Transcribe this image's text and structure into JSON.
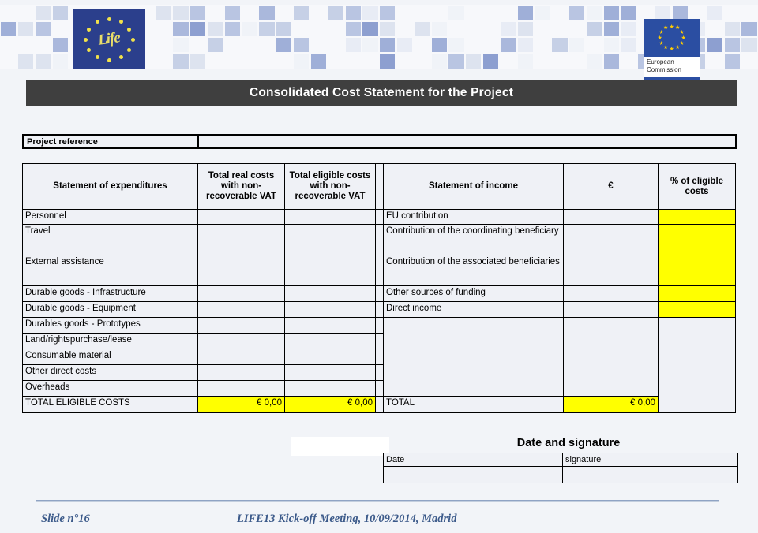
{
  "header": {
    "life_logo_word": "Life",
    "ec_logo_line1": "European",
    "ec_logo_line2": "Commission"
  },
  "title": "Consolidated Cost Statement for the Project",
  "project_reference": {
    "label": "Project reference",
    "value": ""
  },
  "expenditure_table": {
    "headers": {
      "col1": "Statement of expenditures",
      "col2": "Total real costs with non-recoverable VAT",
      "col3": "Total eligible costs with non-recoverable VAT"
    },
    "rows": [
      {
        "label": "Personnel",
        "real": "",
        "eligible": ""
      },
      {
        "label": "Travel",
        "real": "",
        "eligible": ""
      },
      {
        "label": "External assistance",
        "real": "",
        "eligible": ""
      },
      {
        "label": "Durable goods - Infrastructure",
        "real": "",
        "eligible": ""
      },
      {
        "label": "Durable goods - Equipment",
        "real": "",
        "eligible": ""
      },
      {
        "label": "Durables goods - Prototypes",
        "real": "",
        "eligible": ""
      },
      {
        "label": "Land/rightspurchase/lease",
        "real": "",
        "eligible": ""
      },
      {
        "label": "Consumable material",
        "real": "",
        "eligible": ""
      },
      {
        "label": "Other direct costs",
        "real": "",
        "eligible": ""
      },
      {
        "label": "Overheads",
        "real": "",
        "eligible": ""
      }
    ],
    "total": {
      "label": "TOTAL ELIGIBLE COSTS",
      "real": "€ 0,00",
      "eligible": "€ 0,00"
    }
  },
  "income_table": {
    "headers": {
      "col1": "Statement of income",
      "col2": "€",
      "col3": "% of eligible costs"
    },
    "rows": [
      {
        "label": "EU contribution",
        "amount": "",
        "percent": ""
      },
      {
        "label": "Contribution of the coordinating beneficiary",
        "amount": "",
        "percent": ""
      },
      {
        "label": "Contribution of the associated beneficiaries",
        "amount": "",
        "percent": ""
      },
      {
        "label": "Other sources of funding",
        "amount": "",
        "percent": ""
      },
      {
        "label": "Direct income",
        "amount": "",
        "percent": ""
      }
    ],
    "total": {
      "label": "TOTAL",
      "amount": "€ 0,00"
    }
  },
  "date_signature": {
    "title": "Date and signature",
    "date_label": "Date",
    "signature_label": "signature",
    "date_value": "",
    "signature_value": ""
  },
  "footer": {
    "slide": "Slide n°16",
    "meeting": "LIFE13 Kick-off Meeting, 10/09/2014, Madrid"
  },
  "colors": {
    "highlight": "#ffff00",
    "title_bar": "#3f3f3f",
    "cell_bg": "#eff1f6",
    "page_bg": "#f2f4f8",
    "brand_blue": "#2b4ea2",
    "footer_text": "#3c5a8a"
  }
}
